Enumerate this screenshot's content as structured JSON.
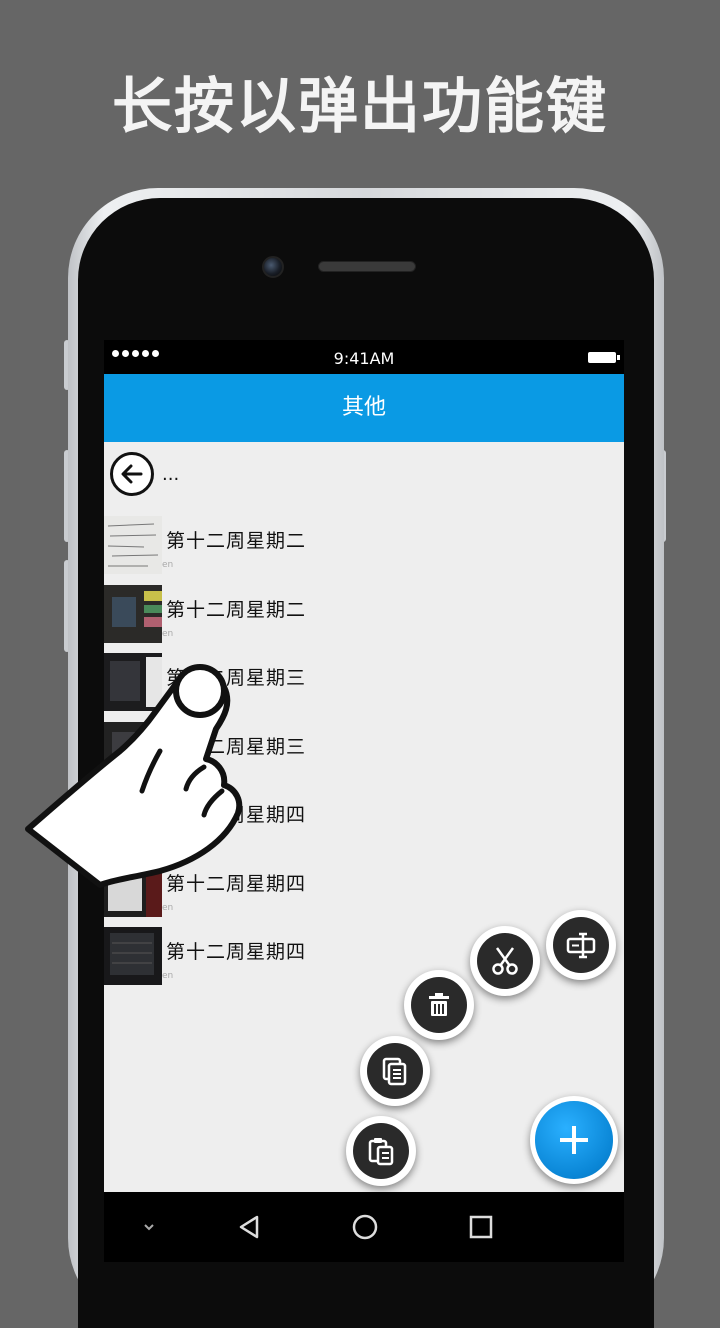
{
  "headline": "长按以弹出功能键",
  "status_bar": {
    "time": "9:41AM"
  },
  "app_bar": {
    "title": "其他"
  },
  "nav_row": {
    "up_label": "..."
  },
  "files": [
    {
      "name": "第十二周星期二",
      "sub": "en"
    },
    {
      "name": "第十二周星期二",
      "sub": "en"
    },
    {
      "name": "第十二周星期三",
      "sub": "en"
    },
    {
      "name": "第十二周星期三",
      "sub": "en"
    },
    {
      "name": "第十二周星期四",
      "sub": "en"
    },
    {
      "name": "第十二周星期四",
      "sub": "en"
    },
    {
      "name": "第十二周星期四",
      "sub": "en"
    }
  ],
  "actions": [
    "paste-icon",
    "copy-icon",
    "delete-icon",
    "cut-icon",
    "rename-icon",
    "add-icon"
  ],
  "colors": {
    "accent": "#0a9ae4",
    "background": "#666666",
    "list_bg": "#eeeeee"
  }
}
